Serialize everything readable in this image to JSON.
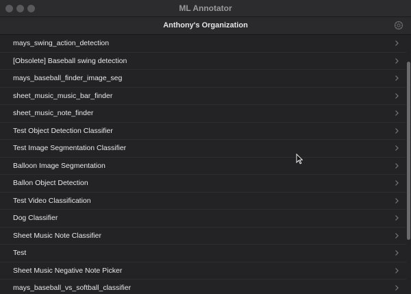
{
  "window": {
    "title": "ML Annotator"
  },
  "navbar": {
    "title": "Anthony's Organization",
    "settings_icon": "gear-icon"
  },
  "projects": [
    {
      "label": "mays_swing_action_detection"
    },
    {
      "label": "[Obsolete] Baseball swing detection"
    },
    {
      "label": "mays_baseball_finder_image_seg"
    },
    {
      "label": "sheet_music_music_bar_finder"
    },
    {
      "label": "sheet_music_note_finder"
    },
    {
      "label": "Test Object Detection Classifier"
    },
    {
      "label": "Test Image Segmentation Classifier"
    },
    {
      "label": "Balloon Image Segmentation"
    },
    {
      "label": "Ballon Object Detection"
    },
    {
      "label": "Test Video Classification"
    },
    {
      "label": "Dog Classifier"
    },
    {
      "label": "Sheet Music Note Classifier"
    },
    {
      "label": "Test"
    },
    {
      "label": "Sheet Music Negative Note Picker"
    },
    {
      "label": "mays_baseball_vs_softball_classifier"
    }
  ],
  "colors": {
    "background": "#232325",
    "text": "#e9e9ea",
    "chevron": "#7a7a7e"
  }
}
